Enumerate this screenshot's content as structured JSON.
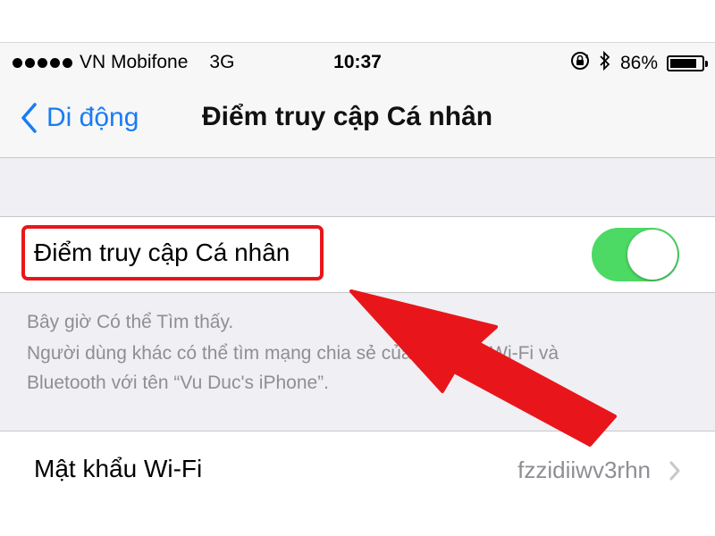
{
  "status_bar": {
    "carrier": "VN Mobifone",
    "network": "3G",
    "time": "10:37",
    "battery_percent": "86%",
    "battery_level": 0.86,
    "icons": [
      "rotation-lock-icon",
      "bluetooth-icon",
      "battery-icon"
    ]
  },
  "nav": {
    "back_label": "Di động",
    "title": "Điểm truy cập Cá nhân"
  },
  "hotspot": {
    "label": "Điểm truy cập Cá nhân",
    "enabled": true
  },
  "footer": {
    "status": "Bây giờ Có thể Tìm thấy.",
    "description_line1": "Người dùng khác có thể tìm mạng chia sẻ của bạn qua Wi-Fi và",
    "description_line2": "Bluetooth với tên “Vu Duc's iPhone”."
  },
  "wifi_password": {
    "label": "Mật khẩu Wi-Fi",
    "value": "fzzidiiwv3rhn"
  },
  "colors": {
    "accent": "#1a7cf3",
    "toggle_on": "#4cd964",
    "annotation_red": "#e8161a",
    "background": "#efeff4"
  }
}
